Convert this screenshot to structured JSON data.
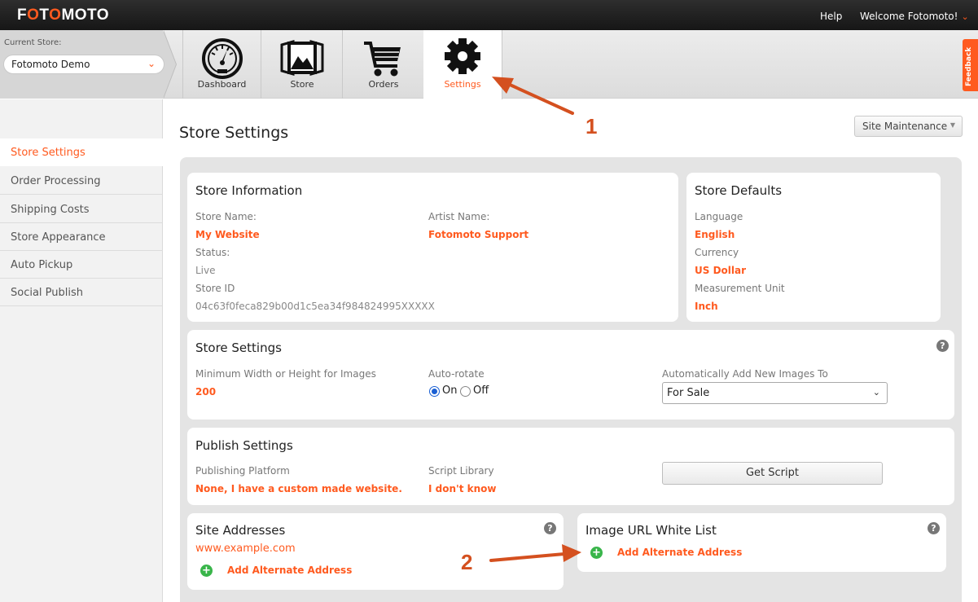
{
  "header": {
    "logo_prefix": "F",
    "logo_o1": "O",
    "logo_mid": "T",
    "logo_o2": "O",
    "logo_rest": "MOTO",
    "help": "Help",
    "welcome": "Welcome Fotomoto!",
    "welcome_chevron": "⌄"
  },
  "store_selector": {
    "label": "Current Store:",
    "value": "Fotomoto Demo",
    "chevron": "⌄"
  },
  "nav": {
    "tabs": [
      {
        "label": "Dashboard",
        "icon": "dashboard-gauge-icon"
      },
      {
        "label": "Store",
        "icon": "store-photos-icon"
      },
      {
        "label": "Orders",
        "icon": "orders-cart-icon"
      },
      {
        "label": "Settings",
        "icon": "settings-gear-icon",
        "active": true
      }
    ]
  },
  "feedback": "Feedback",
  "sidebar": {
    "items": [
      {
        "label": "Store Settings",
        "active": true
      },
      {
        "label": "Order Processing"
      },
      {
        "label": "Shipping Costs"
      },
      {
        "label": "Store Appearance"
      },
      {
        "label": "Auto Pickup"
      },
      {
        "label": "Social Publish"
      }
    ]
  },
  "main": {
    "title": "Store Settings",
    "maintenance_button": "Site Maintenance",
    "maintenance_caret": "▼"
  },
  "store_information": {
    "title": "Store Information",
    "store_name_label": "Store Name:",
    "store_name_value": "My Website",
    "artist_name_label": "Artist Name:",
    "artist_name_value": "Fotomoto Support",
    "status_label": "Status:",
    "status_value": "Live",
    "store_id_label": "Store ID",
    "store_id_value": "04c63f0feca829b00d1c5ea34f984824995XXXXX"
  },
  "store_defaults": {
    "title": "Store Defaults",
    "language_label": "Language",
    "language_value": "English",
    "currency_label": "Currency",
    "currency_value": "US Dollar",
    "unit_label": "Measurement Unit",
    "unit_value": "Inch"
  },
  "store_settings": {
    "title": "Store Settings",
    "help": "?",
    "min_size_label": "Minimum Width or Height for Images",
    "min_size_value": "200",
    "autorotate_label": "Auto-rotate",
    "autorotate_on": "On",
    "autorotate_off": "Off",
    "autorotate_selected": "On",
    "auto_add_label": "Automatically Add New Images To",
    "auto_add_value": "For Sale",
    "auto_add_chevron": "⌄"
  },
  "publish_settings": {
    "title": "Publish Settings",
    "platform_label": "Publishing Platform",
    "platform_value": "None, I have a custom made website.",
    "script_label": "Script Library",
    "script_value": "I don't know",
    "get_script": "Get Script"
  },
  "site_addresses": {
    "title": "Site Addresses",
    "help": "?",
    "address": "www.example.com",
    "plus": "+",
    "add_label": "Add Alternate Address"
  },
  "image_whitelist": {
    "title": "Image URL White List",
    "help": "?",
    "plus": "+",
    "add_label": "Add Alternate Address"
  },
  "annotations": {
    "one": "1",
    "two": "2",
    "color": "#d4501f"
  },
  "colors": {
    "accent": "#ff5a1f",
    "add_green": "#39b54a",
    "topbar": "#1e1e1e"
  }
}
